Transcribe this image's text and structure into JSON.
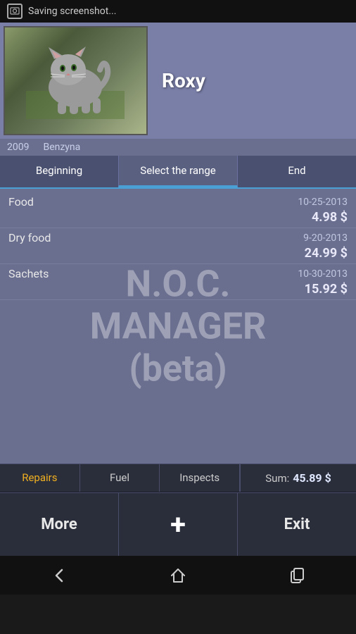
{
  "statusBar": {
    "label": "Saving screenshot..."
  },
  "header": {
    "petName": "Roxy",
    "year": "2009",
    "brand": "Benzyna"
  },
  "rangeTabs": {
    "beginning": "Beginning",
    "selectRange": "Select the range",
    "end": "End"
  },
  "expenses": [
    {
      "label": "Food",
      "date": "10-25-2013",
      "amount": "4.98 $"
    },
    {
      "label": "Dry food",
      "date": "9-20-2013",
      "amount": "24.99 $"
    },
    {
      "label": "Sachets",
      "date": "10-30-2013",
      "amount": "15.92 $"
    }
  ],
  "watermark": {
    "line1": "N.O.C.",
    "line2": "MANAGER",
    "line3": "(beta)"
  },
  "bottomTabs": [
    {
      "label": "Repairs",
      "active": true
    },
    {
      "label": "Fuel",
      "active": false
    },
    {
      "label": "Inspects",
      "active": false
    }
  ],
  "sum": {
    "label": "Sum:",
    "value": "45.89 $"
  },
  "actionButtons": {
    "more": "More",
    "plus": "+",
    "exit": "Exit"
  },
  "navBar": {
    "back": "←",
    "home": "⌂",
    "recent": "▭"
  }
}
